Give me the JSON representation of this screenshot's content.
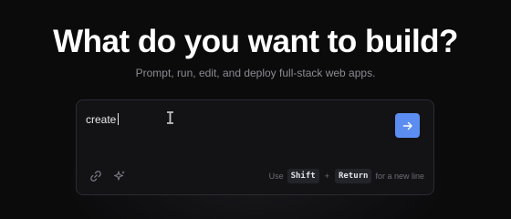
{
  "hero": {
    "title": "What do you want to build?",
    "subtitle": "Prompt, run, edit, and deploy full-stack web apps."
  },
  "prompt": {
    "value": "create",
    "submit_icon": "arrow-right-icon",
    "tools": [
      "link-icon",
      "sparkles-icon"
    ],
    "hint_prefix": "Use",
    "hint_key1": "Shift",
    "hint_plus": "+",
    "hint_key2": "Return",
    "hint_suffix": "for a new line"
  },
  "colors": {
    "background": "#0b0b0c",
    "accent": "#5b8ef0",
    "muted_text": "#8b8b93"
  }
}
